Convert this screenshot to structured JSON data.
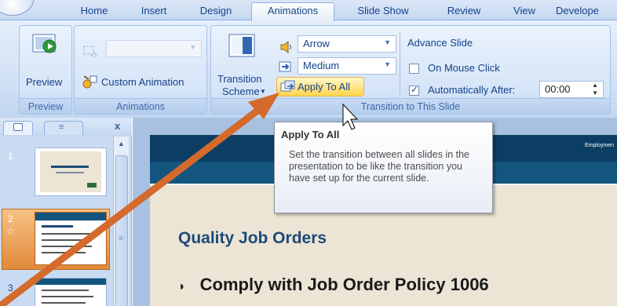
{
  "tabs": [
    "Home",
    "Insert",
    "Design",
    "Animations",
    "Slide Show",
    "Review",
    "View",
    "Develope"
  ],
  "active_tab": "Animations",
  "groups": {
    "preview": {
      "button_label": "Preview",
      "caption": "Preview"
    },
    "animations": {
      "custom_animation_label": "Custom Animation",
      "caption": "Animations",
      "animate_combo_value": ""
    },
    "transition": {
      "scheme_label_line1": "Transition",
      "scheme_label_line2": "Scheme",
      "sound_value": "Arrow",
      "speed_value": "Medium",
      "apply_to_all_label": "Apply To All",
      "caption": "Transition to This Slide",
      "advance_header": "Advance Slide",
      "on_mouse_click_label": "On Mouse Click",
      "on_mouse_click_checked": false,
      "auto_after_label": "Automatically After:",
      "auto_after_checked": true,
      "auto_after_value": "00:00"
    }
  },
  "tooltip": {
    "title": "Apply To All",
    "body": "Set the transition between all slides in the presentation to be like the transition you have set up for the current slide."
  },
  "slides_pane": {
    "slide_numbers": [
      "1",
      "2",
      "3"
    ],
    "selected": "2",
    "close_label": "x"
  },
  "slide": {
    "header_text": "Employmen",
    "title": "Quality Job Orders",
    "bullet": "Comply with Job Order Policy 1006"
  },
  "colors": {
    "accent_orange_arrow": "#d46a2b",
    "slide_header": "#0c3e63",
    "slide_title": "#1d4a78",
    "ribbon_text": "#15428b"
  }
}
